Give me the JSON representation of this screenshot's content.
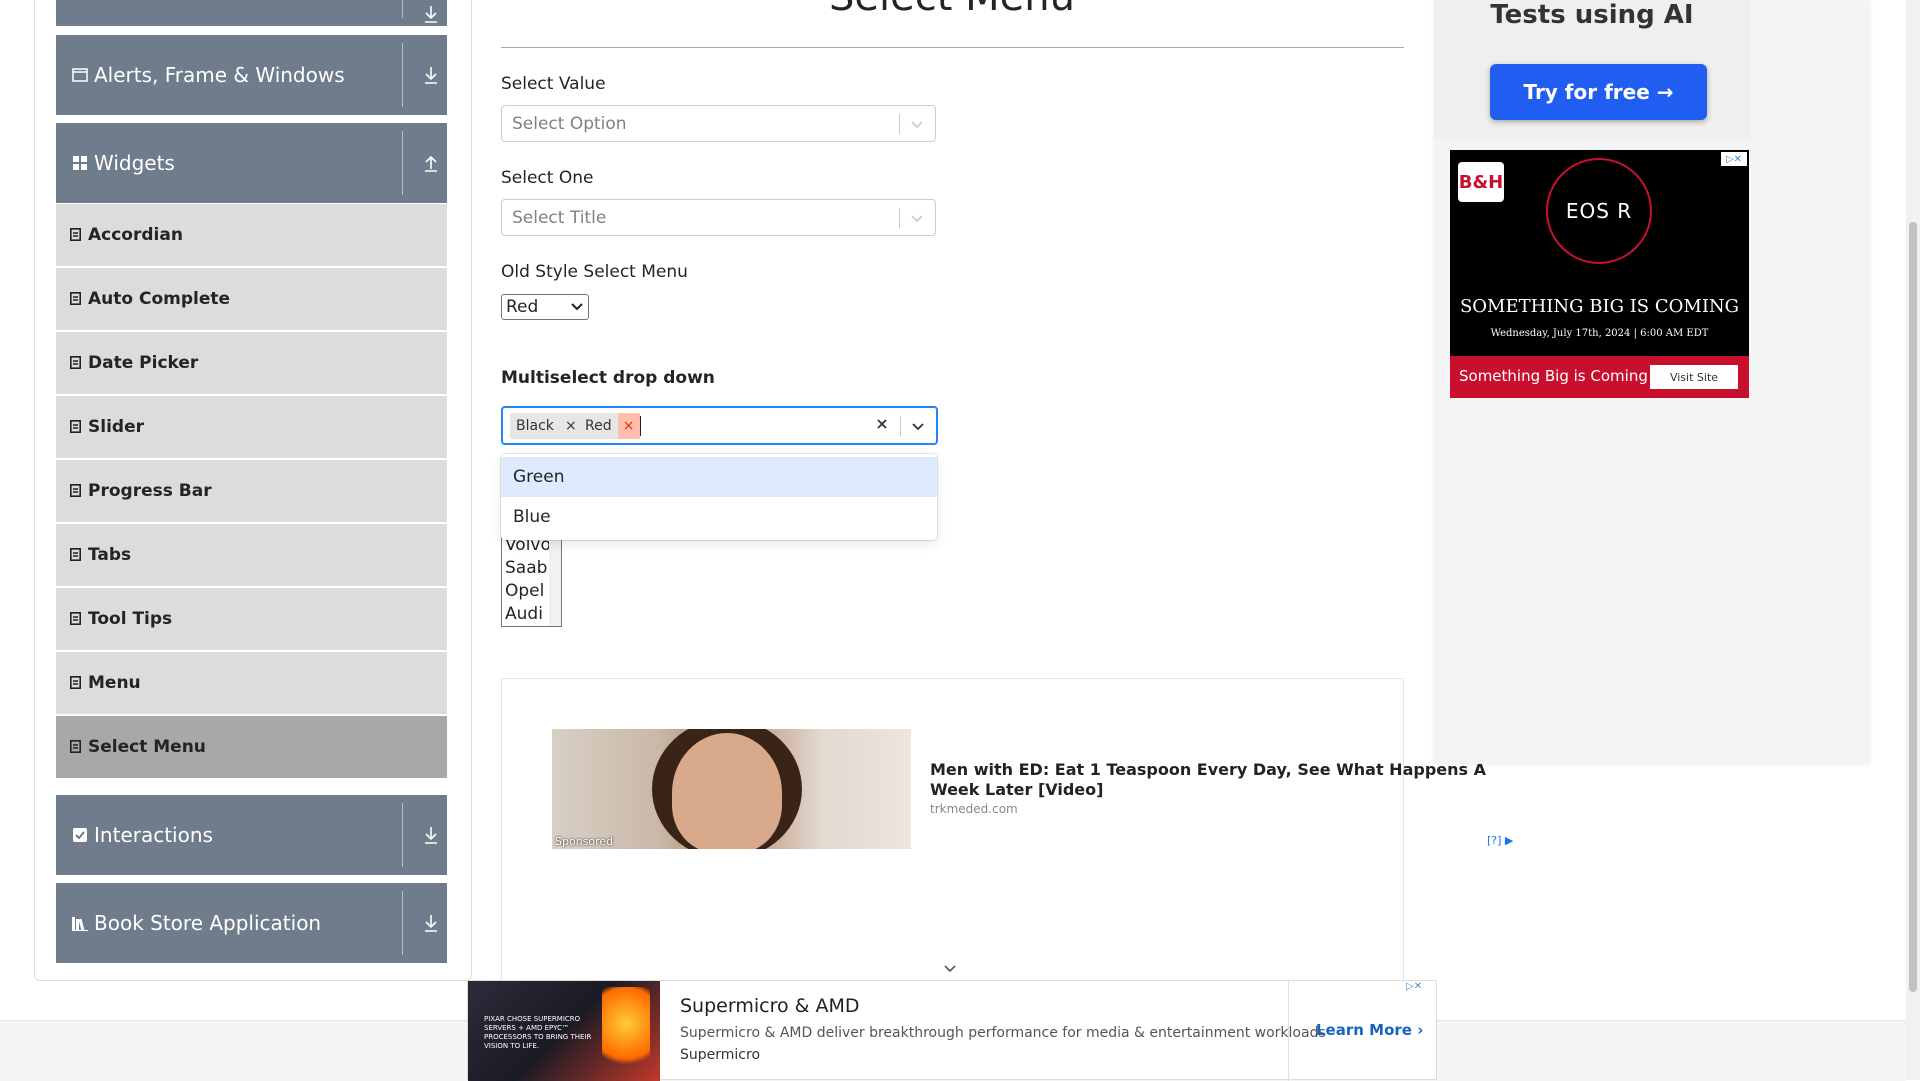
{
  "sidebar": {
    "groups": [
      {
        "label": "",
        "icon": "collapse-arrow-icon"
      },
      {
        "label": "Alerts, Frame & Windows",
        "icon": "window-icon"
      },
      {
        "label": "Widgets",
        "icon": "widgets-icon"
      },
      {
        "label": "Interactions",
        "icon": "interactions-icon"
      },
      {
        "label": "Book Store Application",
        "icon": "book-icon"
      }
    ],
    "widget_items": [
      {
        "label": "Accordian"
      },
      {
        "label": "Auto Complete"
      },
      {
        "label": "Date Picker"
      },
      {
        "label": "Slider"
      },
      {
        "label": "Progress Bar"
      },
      {
        "label": "Tabs"
      },
      {
        "label": "Tool Tips"
      },
      {
        "label": "Menu"
      },
      {
        "label": "Select Menu",
        "active": true
      }
    ]
  },
  "main": {
    "title": "Select Menu",
    "select_value": {
      "label": "Select Value",
      "placeholder": "Select Option"
    },
    "select_one": {
      "label": "Select One",
      "placeholder": "Select Title"
    },
    "old_style": {
      "label": "Old Style Select Menu",
      "selected": "Red"
    },
    "multiselect": {
      "label": "Multiselect drop down",
      "chips": [
        "Black",
        "Red"
      ],
      "chip_remove": "×",
      "clear": "✕",
      "options": [
        "Green",
        "Blue"
      ]
    },
    "cars": {
      "visible_items": [
        "Volvo",
        "Saab",
        "Opel",
        "Audi"
      ]
    }
  },
  "ads": {
    "middle": {
      "headline": "Men with ED: Eat 1 Teaspoon Every Day, See What Happens A Week Later [Video]",
      "domain": "trkmeded.com",
      "sponsored": "Sponsored",
      "choice": "[?]"
    },
    "right_top": {
      "tagline": "Tests using AI",
      "button": "Try for free →"
    },
    "bh": {
      "logo": "B&H",
      "ring_text": "EOS R",
      "headline": "SOMETHING BIG IS COMING",
      "date": "Wednesday, July 17th, 2024 | 6:00 AM EDT",
      "footer": "Something Big is Coming",
      "visit": "Visit Site"
    },
    "bottom": {
      "thumb_text": "PIXAR CHOSE SUPERMICRO SERVERS + AMD EPYC™ PROCESSORS TO BRING THEIR VISION TO LIFE.",
      "title": "Supermicro & AMD",
      "description": "Supermicro & AMD deliver breakthrough performance for media & entertainment workloads",
      "brand": "Supermicro",
      "cta": "Learn More"
    }
  },
  "colors": {
    "sidebar_group": "#6f7c8b",
    "sidebar_item": "#dcdcdc",
    "sidebar_item_active": "#a8a8a8",
    "focus_border": "#2684ff",
    "option_focused": "#deebff",
    "chip_remove_hover": "#ffbdad",
    "try_button": "#1f5ef1",
    "bh_red": "#c8102e"
  }
}
